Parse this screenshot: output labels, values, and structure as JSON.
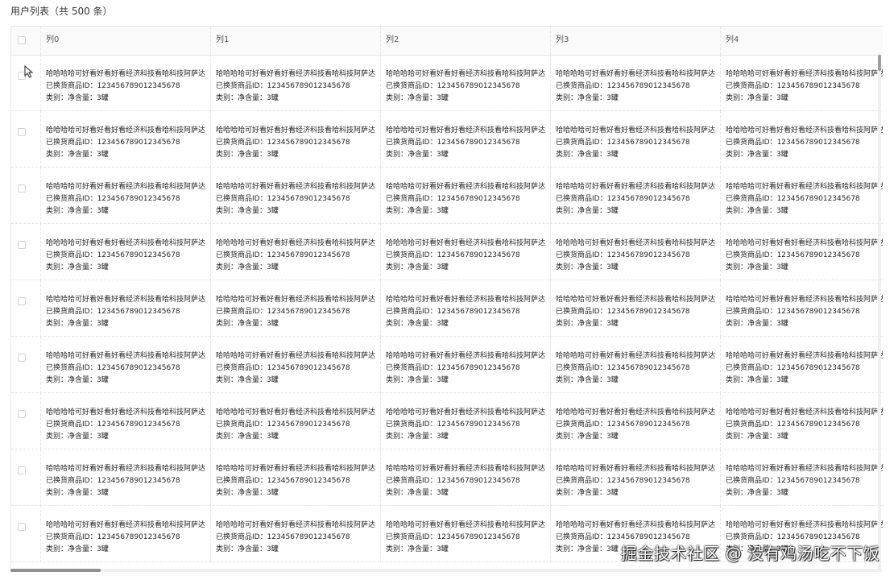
{
  "title": "用户列表（共 500 条）",
  "columns": [
    "列0",
    "列1",
    "列2",
    "列3",
    "列4"
  ],
  "cell": {
    "line1": "哈哈哈哈可好看好看好看经济科技看哈科技阿萨达",
    "line2": "已换货商品ID：12345678901234567​8",
    "line3": "类别：净含量：3罐"
  },
  "rows": 9,
  "watermark": "掘金技术社区 @ 没有鸡汤吃不下饭",
  "icons": {
    "cursor": "mouse-pointer-icon",
    "checkbox": "checkbox-icon"
  }
}
